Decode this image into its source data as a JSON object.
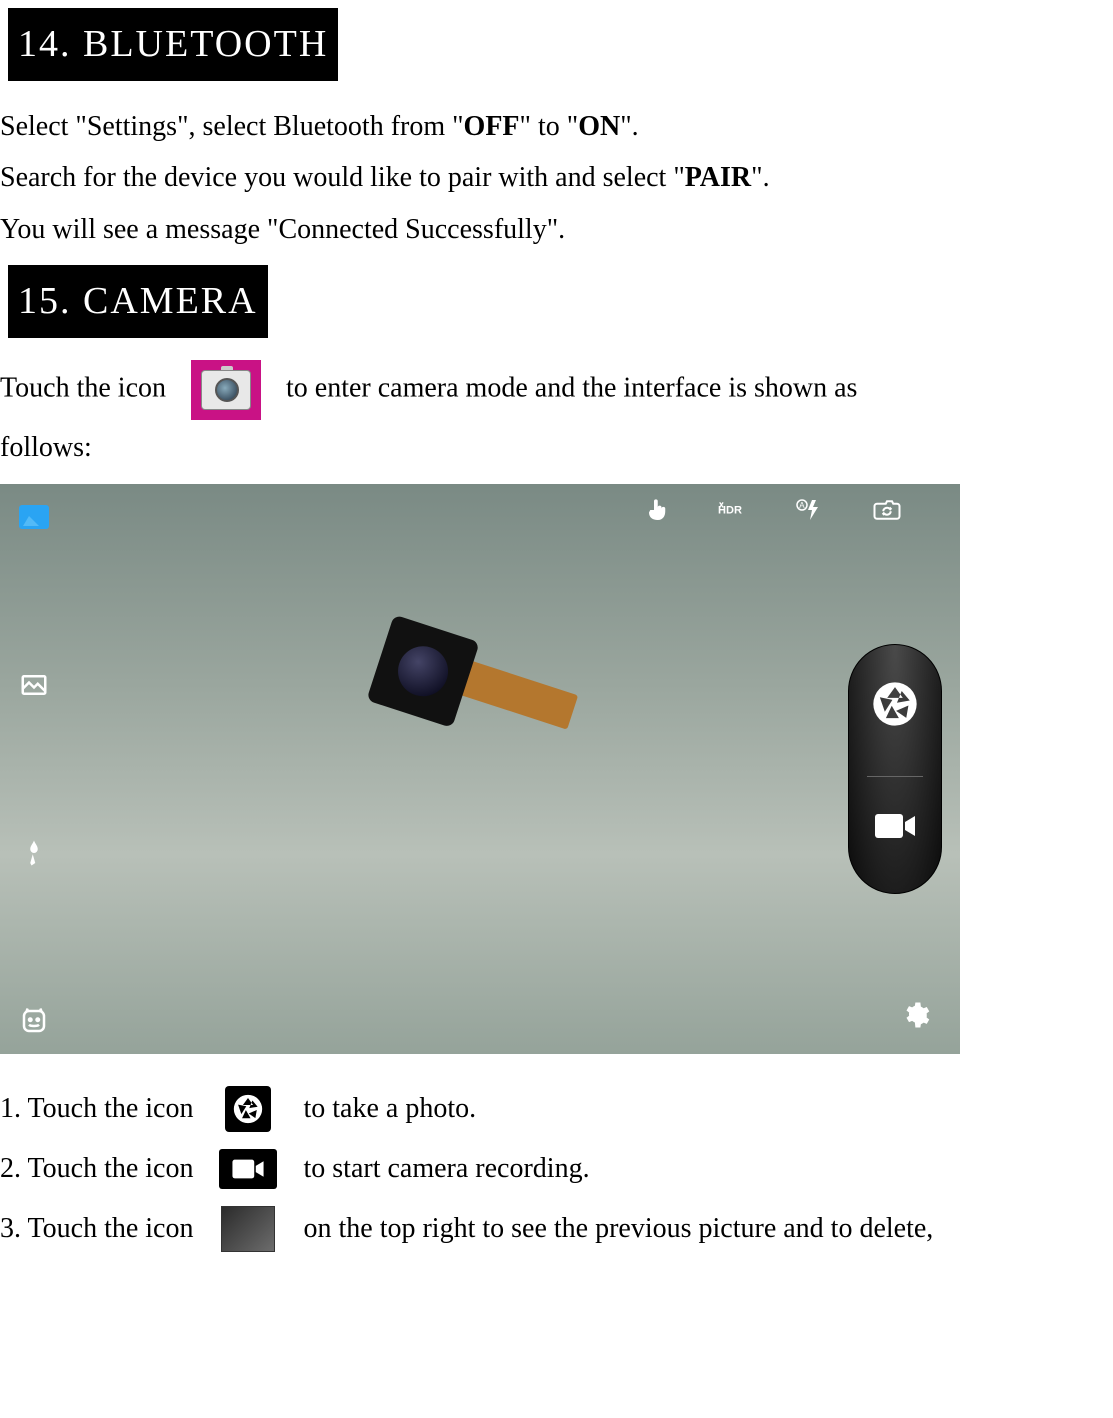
{
  "section14": {
    "heading": "14. BLUETOOTH"
  },
  "bluetooth": {
    "line1_a": "Select \"Settings\", select Bluetooth from \"",
    "line1_off": "OFF",
    "line1_b": "\" to \"",
    "line1_on": "ON",
    "line1_c": "\".",
    "line2_a": "Search for the device you would like to pair with and select \"",
    "line2_pair": "PAIR",
    "line2_b": "\".",
    "line3": "You will see a message \"Connected Successfully\"."
  },
  "section15": {
    "heading": "15.  CAMERA"
  },
  "camera_intro": {
    "before": "Touch the icon",
    "after": "to enter camera mode and the interface is shown as",
    "follows": "follows:"
  },
  "list": {
    "r1_a": "1. Touch the icon",
    "r1_b": "to take a photo.",
    "r2_a": "2. Touch the icon",
    "r2_b": "to start camera recording.",
    "r3_a": "3. Touch the icon",
    "r3_b": "on the top right to see the previous picture and to delete,"
  }
}
